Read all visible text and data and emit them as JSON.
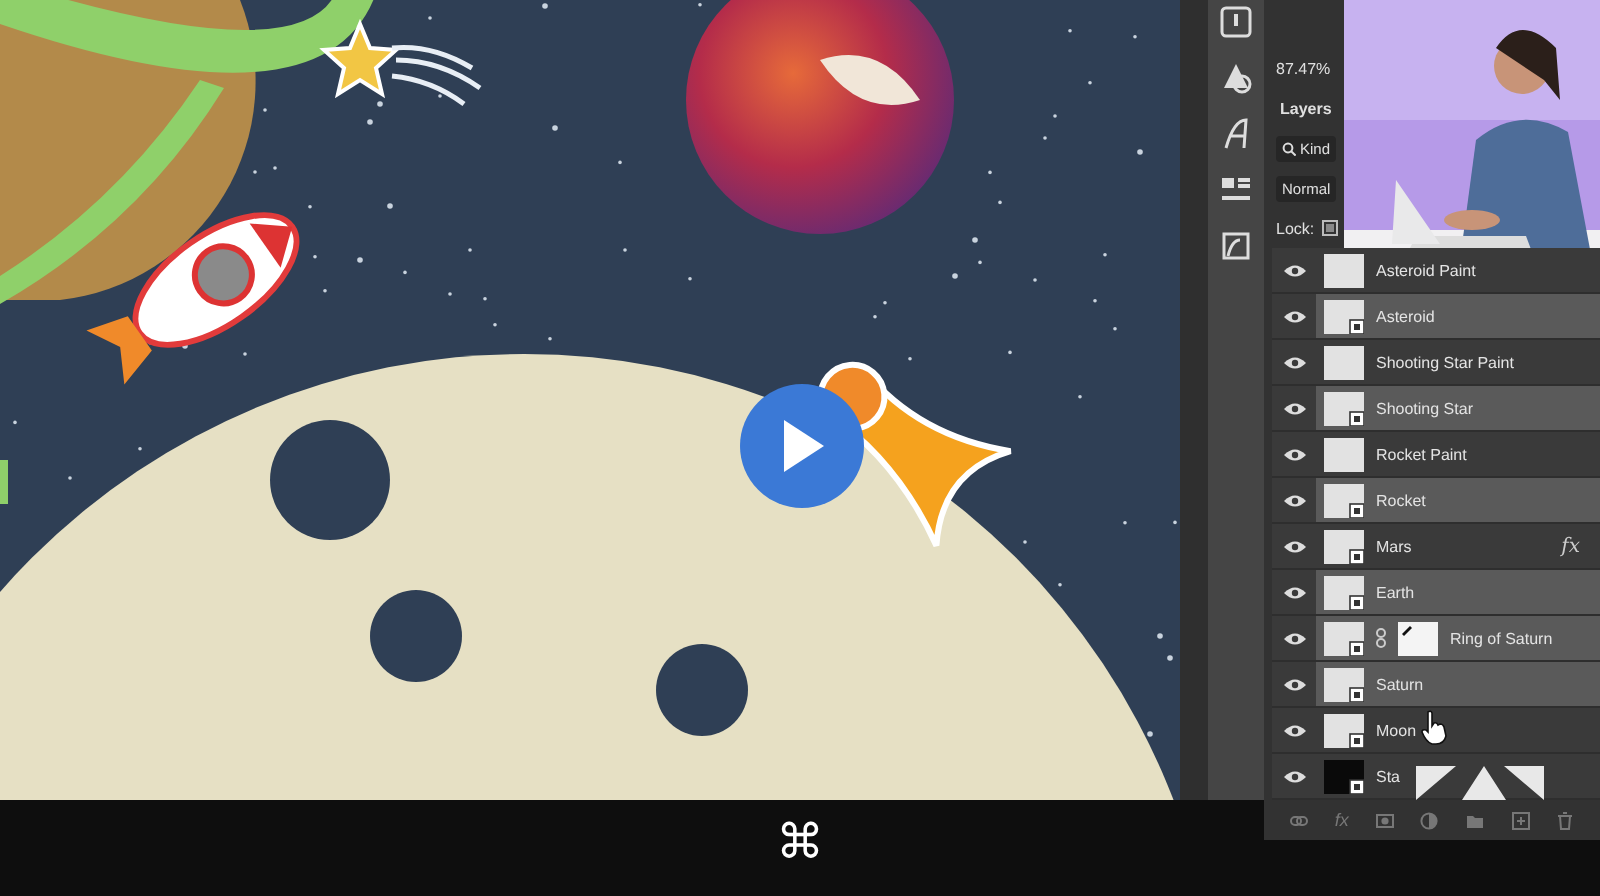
{
  "zoom": "87.47%",
  "panel": {
    "tab": "Layers",
    "filter": "Kind",
    "blend_mode": "Normal",
    "lock_label": "Lock:"
  },
  "layers": [
    {
      "name": "Asteroid Paint",
      "kind": "pixel",
      "selected": false,
      "visible": true
    },
    {
      "name": "Asteroid",
      "kind": "smart",
      "selected": true,
      "visible": true
    },
    {
      "name": "Shooting Star Paint",
      "kind": "pixel",
      "selected": false,
      "visible": true
    },
    {
      "name": "Shooting Star",
      "kind": "smart",
      "selected": true,
      "visible": true
    },
    {
      "name": "Rocket Paint",
      "kind": "pixel",
      "selected": false,
      "visible": true
    },
    {
      "name": "Rocket",
      "kind": "smart",
      "selected": true,
      "visible": true
    },
    {
      "name": "Mars",
      "kind": "smart",
      "selected": false,
      "visible": true,
      "fx": "fx"
    },
    {
      "name": "Earth",
      "kind": "smart",
      "selected": true,
      "visible": true
    },
    {
      "name": "Ring of Saturn",
      "kind": "masked",
      "selected": true,
      "visible": true
    },
    {
      "name": "Saturn",
      "kind": "smart",
      "selected": true,
      "visible": true
    },
    {
      "name": "Moon",
      "kind": "smart",
      "selected": false,
      "visible": true
    },
    {
      "name": "Sta",
      "kind": "smart",
      "selected": false,
      "visible": true
    }
  ],
  "footer": {
    "effects_button": "fx"
  },
  "player": {
    "shortcut": "⌘"
  }
}
